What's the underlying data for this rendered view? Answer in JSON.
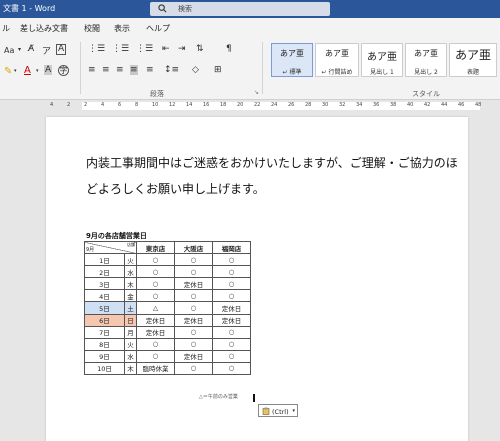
{
  "window": {
    "title": "文書 1  -  Word"
  },
  "search": {
    "text": "検索"
  },
  "menu": [
    "ル",
    "差し込み文書",
    "校閲",
    "表示",
    "ヘルプ"
  ],
  "ribbon": {
    "font_size_label": "Aa",
    "paragraph_group": "段落",
    "styles_group": "スタイル",
    "styles": [
      {
        "sample": "あア亜",
        "name": "↵ 標準",
        "selected": true
      },
      {
        "sample": "あア亜",
        "name": "↵ 行間詰め"
      },
      {
        "sample": "あア亜",
        "name": "見出し 1"
      },
      {
        "sample": "あア亜",
        "name": "見出し 2"
      },
      {
        "sample": "あア亜",
        "name": "表題"
      }
    ]
  },
  "ruler": {
    "ticks": [
      "4",
      "2",
      "2",
      "4",
      "6",
      "8",
      "10",
      "12",
      "14",
      "16",
      "18",
      "20",
      "22",
      "24",
      "26",
      "28",
      "30",
      "32",
      "34",
      "36",
      "38",
      "40",
      "42",
      "44",
      "46",
      "48"
    ]
  },
  "document": {
    "paragraph_line1": "内装工事期間中はご迷惑をおかけいたしますが、ご理解・ご協力のほ",
    "paragraph_line2": "どよろしくお願い申し上げます。",
    "table_caption": "9月の各店舗営業日",
    "table": {
      "corner_left": "9月",
      "corner_right": "店舗",
      "headers": [
        "東京店",
        "大阪店",
        "福岡店"
      ],
      "rows": [
        {
          "date": "1日",
          "dow": "火",
          "cells": [
            "○",
            "○",
            "○"
          ]
        },
        {
          "date": "2日",
          "dow": "水",
          "cells": [
            "○",
            "○",
            "○"
          ]
        },
        {
          "date": "3日",
          "dow": "木",
          "cells": [
            "○",
            "定休日",
            "○"
          ]
        },
        {
          "date": "4日",
          "dow": "金",
          "cells": [
            "○",
            "○",
            "○"
          ]
        },
        {
          "date": "5日",
          "dow": "土",
          "cells": [
            "△",
            "○",
            "定休日"
          ],
          "highlight": "sat"
        },
        {
          "date": "6日",
          "dow": "日",
          "cells": [
            "定休日",
            "定休日",
            "定休日"
          ],
          "highlight": "sun"
        },
        {
          "date": "7日",
          "dow": "月",
          "cells": [
            "定休日",
            "○",
            "○"
          ]
        },
        {
          "date": "8日",
          "dow": "火",
          "cells": [
            "○",
            "○",
            "○"
          ]
        },
        {
          "date": "9日",
          "dow": "水",
          "cells": [
            "○",
            "定休日",
            "○"
          ]
        },
        {
          "date": "10日",
          "dow": "木",
          "cells": [
            "臨時休業",
            "○",
            "○"
          ]
        }
      ]
    },
    "legend": "△＝午前のみ営業",
    "paste_options": "(Ctrl)"
  }
}
